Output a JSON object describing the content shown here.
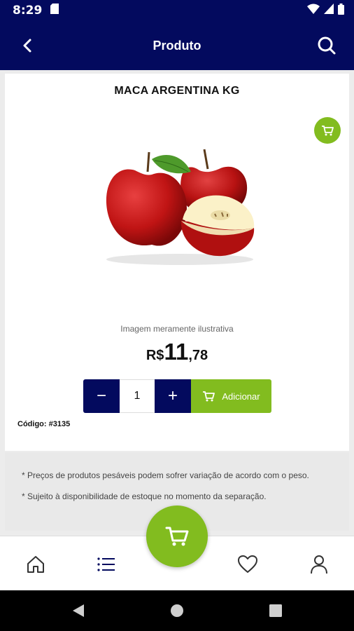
{
  "status_bar": {
    "time": "8:29"
  },
  "app_bar": {
    "title": "Produto"
  },
  "product": {
    "name": "MACA ARGENTINA KG",
    "image_caption": "Imagem meramente ilustrativa",
    "price_currency": "R$",
    "price_integer": "11",
    "price_decimal": ",78",
    "quantity": "1",
    "code": "Código: #3135"
  },
  "actions": {
    "minus": "−",
    "plus": "+",
    "add_label": "Adicionar"
  },
  "notes": [
    "* Preços de produtos pesáveis podem sofrer variação de acordo com o peso.",
    "* Sujeito à disponibilidade de estoque no momento da separação."
  ],
  "bottom_nav": {
    "items": [
      "home-icon",
      "list-icon",
      "cart-icon",
      "heart-icon",
      "user-icon"
    ]
  },
  "colors": {
    "primary": "#030a5e",
    "accent": "#82bc1f"
  }
}
